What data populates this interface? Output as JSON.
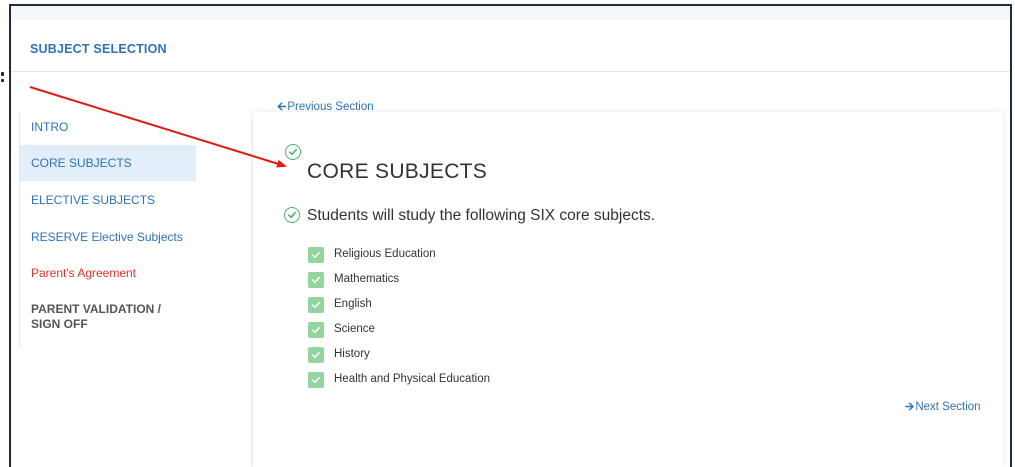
{
  "panel": {
    "title": "SUBJECT SELECTION"
  },
  "sidebar": {
    "items": [
      {
        "label": "INTRO",
        "state": "normal"
      },
      {
        "label": "CORE SUBJECTS",
        "state": "active"
      },
      {
        "label": "ELECTIVE SUBJECTS",
        "state": "normal"
      },
      {
        "label": "RESERVE Elective Subjects",
        "state": "normal"
      },
      {
        "label": "Parent's Agreement",
        "state": "warning"
      },
      {
        "label": "PARENT VALIDATION / SIGN OFF",
        "state": "pending"
      }
    ]
  },
  "navigation": {
    "previous_label": "Previous Section",
    "next_label": "Next Section"
  },
  "section": {
    "title": "CORE SUBJECTS",
    "intro": "Students will study the following SIX core subjects.",
    "subjects": [
      "Religious Education",
      "Mathematics",
      "English",
      "Science",
      "History",
      "Health and Physical Education"
    ]
  },
  "colors": {
    "accent": "#2f72b8",
    "active_bg": "#e3eefb",
    "warning": "#e0332b",
    "check_green": "#49b36a",
    "checkbox_green": "#93d59e",
    "annotation_arrow": "#e01b14",
    "frame_border": "#1f2a44"
  },
  "icons": {
    "previous": "arrow-left-icon",
    "next": "arrow-right-icon",
    "section_status": "check-circle-icon",
    "subject_status": "checkbox-checked-icon"
  }
}
